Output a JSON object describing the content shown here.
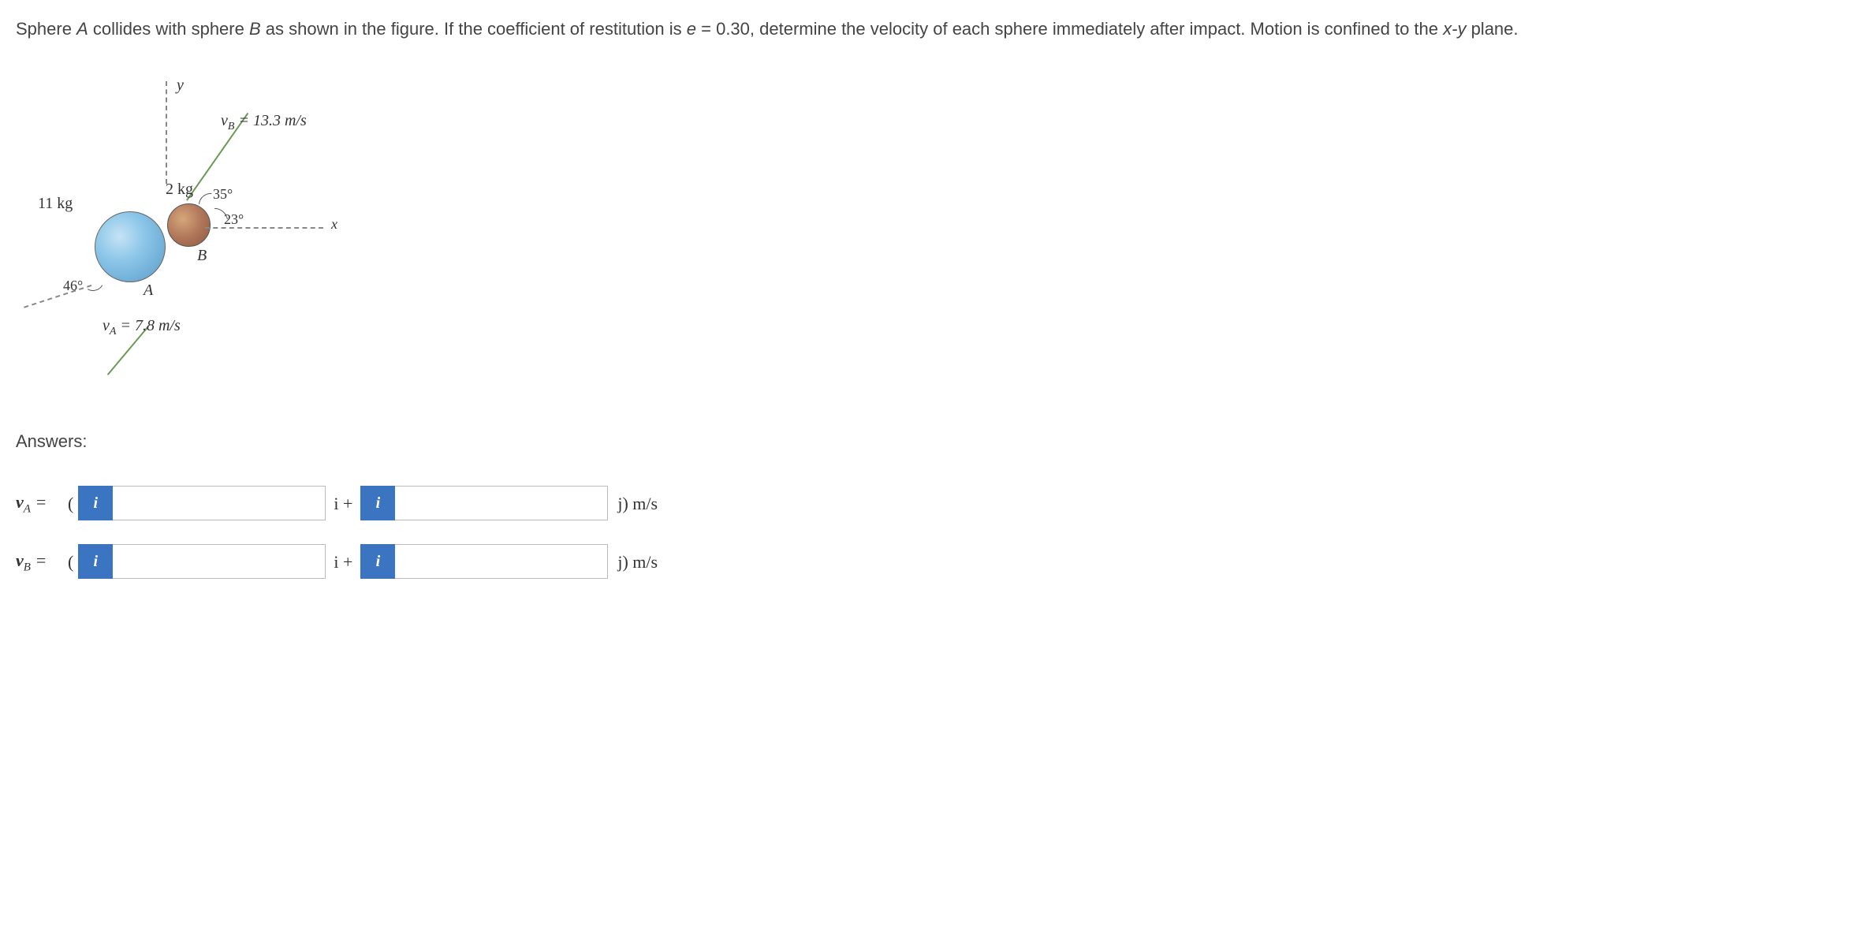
{
  "problem": {
    "text_part1": "Sphere ",
    "sphereA": "A",
    "text_part2": " collides with sphere ",
    "sphereB": "B",
    "text_part3": " as shown in the figure. If the coefficient of restitution is ",
    "e_var": "e",
    "text_part4": " = 0.30, determine the velocity of each sphere immediately after impact. Motion is confined to the ",
    "xy": "x-y",
    "text_part5": " plane."
  },
  "figure": {
    "y_label": "y",
    "x_label": "x",
    "vB_label": "v",
    "vB_sub": "B",
    "vB_value": " = 13.3 m/s",
    "vA_label": "v",
    "vA_sub": "A",
    "vA_value": " = 7.8 m/s",
    "mass_a": "11 kg",
    "mass_b": "2 kg",
    "angle_35": "35°",
    "angle_23": "23°",
    "angle_46": "46°",
    "label_A": "A",
    "label_B": "B"
  },
  "answers": {
    "header": "Answers:",
    "rowA": {
      "label_v": "v",
      "label_sub": "A",
      "equals": " =",
      "open_paren": "(",
      "i_plus": "i +",
      "close_unit": "j) m/s",
      "info": "i"
    },
    "rowB": {
      "label_v": "v",
      "label_sub": "B",
      "equals": " =",
      "open_paren": "(",
      "i_plus": "i +",
      "close_unit": "j) m/s",
      "info": "i"
    }
  }
}
